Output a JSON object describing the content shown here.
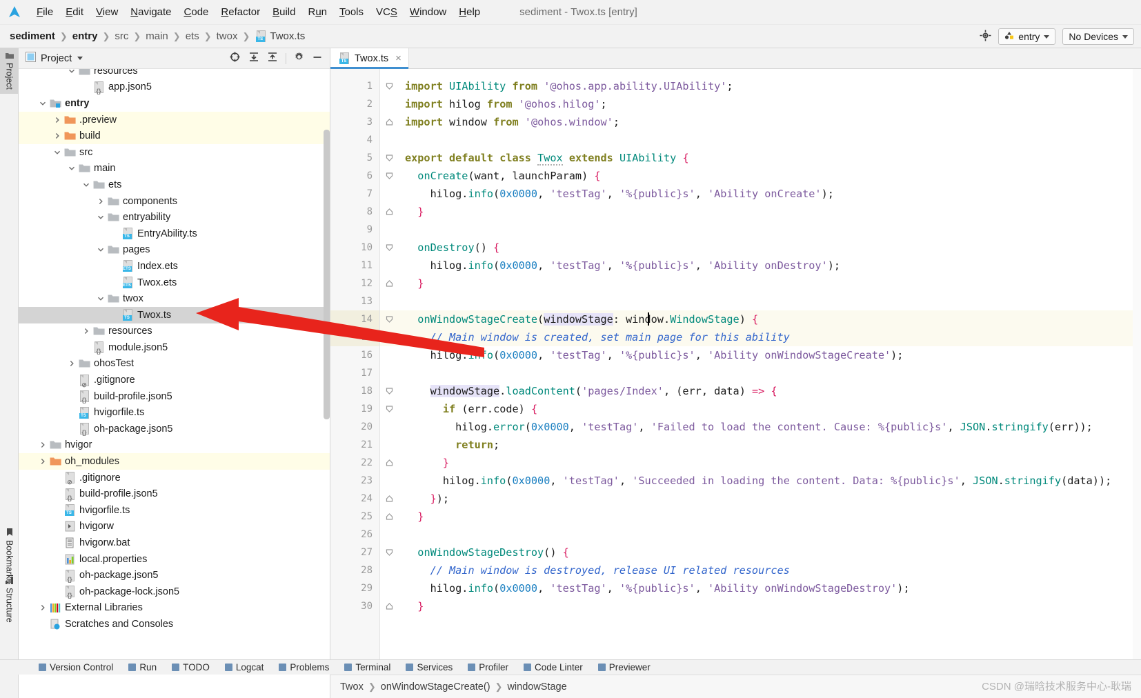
{
  "window": {
    "title": "sediment - Twox.ts [entry]"
  },
  "menubar": {
    "items": [
      {
        "label": "File",
        "mnemonic": "F"
      },
      {
        "label": "Edit",
        "mnemonic": "E"
      },
      {
        "label": "View",
        "mnemonic": "V"
      },
      {
        "label": "Navigate",
        "mnemonic": "N"
      },
      {
        "label": "Code",
        "mnemonic": "C"
      },
      {
        "label": "Refactor",
        "mnemonic": "R"
      },
      {
        "label": "Build",
        "mnemonic": "B"
      },
      {
        "label": "Run",
        "mnemonic": "u"
      },
      {
        "label": "Tools",
        "mnemonic": "T"
      },
      {
        "label": "VCS",
        "mnemonic": "S"
      },
      {
        "label": "Window",
        "mnemonic": "W"
      },
      {
        "label": "Help",
        "mnemonic": "H"
      }
    ]
  },
  "navbar": {
    "breadcrumb": [
      "sediment",
      "entry",
      "src",
      "main",
      "ets",
      "twox",
      "Twox.ts"
    ],
    "run_config": "entry",
    "device_selector": "No Devices"
  },
  "left_strip": {
    "tools": [
      {
        "label": "Project",
        "active": true
      },
      {
        "label": "Bookmarks",
        "active": false
      },
      {
        "label": "Structure",
        "active": false
      }
    ]
  },
  "project_panel": {
    "title": "Project",
    "tree": [
      {
        "label": "resources",
        "depth": 3,
        "type": "folder",
        "arrow": "down",
        "state": "none",
        "clipped": true
      },
      {
        "label": "app.json5",
        "depth": 4,
        "type": "json",
        "arrow": "none",
        "state": "none"
      },
      {
        "label": "entry",
        "depth": 1,
        "type": "module",
        "arrow": "down",
        "state": "none",
        "bold": true
      },
      {
        "label": ".preview",
        "depth": 2,
        "type": "folder-orange",
        "arrow": "right",
        "state": "yellow"
      },
      {
        "label": "build",
        "depth": 2,
        "type": "folder-orange",
        "arrow": "right",
        "state": "yellow"
      },
      {
        "label": "src",
        "depth": 2,
        "type": "folder",
        "arrow": "down",
        "state": "none"
      },
      {
        "label": "main",
        "depth": 3,
        "type": "folder",
        "arrow": "down",
        "state": "none"
      },
      {
        "label": "ets",
        "depth": 4,
        "type": "folder",
        "arrow": "down",
        "state": "none"
      },
      {
        "label": "components",
        "depth": 5,
        "type": "folder",
        "arrow": "right",
        "state": "none"
      },
      {
        "label": "entryability",
        "depth": 5,
        "type": "folder",
        "arrow": "down",
        "state": "none"
      },
      {
        "label": "EntryAbility.ts",
        "depth": 6,
        "type": "ts",
        "arrow": "none",
        "state": "none"
      },
      {
        "label": "pages",
        "depth": 5,
        "type": "folder",
        "arrow": "down",
        "state": "none"
      },
      {
        "label": "Index.ets",
        "depth": 6,
        "type": "ets",
        "arrow": "none",
        "state": "none"
      },
      {
        "label": "Twox.ets",
        "depth": 6,
        "type": "ets",
        "arrow": "none",
        "state": "none"
      },
      {
        "label": "twox",
        "depth": 5,
        "type": "folder",
        "arrow": "down",
        "state": "none"
      },
      {
        "label": "Twox.ts",
        "depth": 6,
        "type": "ts",
        "arrow": "none",
        "state": "selected"
      },
      {
        "label": "resources",
        "depth": 4,
        "type": "folder",
        "arrow": "right",
        "state": "none"
      },
      {
        "label": "module.json5",
        "depth": 4,
        "type": "json",
        "arrow": "none",
        "state": "none"
      },
      {
        "label": "ohosTest",
        "depth": 3,
        "type": "folder",
        "arrow": "right",
        "state": "none"
      },
      {
        "label": ".gitignore",
        "depth": 3,
        "type": "gitignore",
        "arrow": "none",
        "state": "none"
      },
      {
        "label": "build-profile.json5",
        "depth": 3,
        "type": "json",
        "arrow": "none",
        "state": "none"
      },
      {
        "label": "hvigorfile.ts",
        "depth": 3,
        "type": "ts",
        "arrow": "none",
        "state": "none"
      },
      {
        "label": "oh-package.json5",
        "depth": 3,
        "type": "json",
        "arrow": "none",
        "state": "none"
      },
      {
        "label": "hvigor",
        "depth": 1,
        "type": "folder",
        "arrow": "right",
        "state": "none"
      },
      {
        "label": "oh_modules",
        "depth": 1,
        "type": "folder-orange",
        "arrow": "right",
        "state": "yellow"
      },
      {
        "label": ".gitignore",
        "depth": 2,
        "type": "gitignore",
        "arrow": "none",
        "state": "none"
      },
      {
        "label": "build-profile.json5",
        "depth": 2,
        "type": "json",
        "arrow": "none",
        "state": "none"
      },
      {
        "label": "hvigorfile.ts",
        "depth": 2,
        "type": "ts",
        "arrow": "none",
        "state": "none"
      },
      {
        "label": "hvigorw",
        "depth": 2,
        "type": "script",
        "arrow": "none",
        "state": "none"
      },
      {
        "label": "hvigorw.bat",
        "depth": 2,
        "type": "bat",
        "arrow": "none",
        "state": "none"
      },
      {
        "label": "local.properties",
        "depth": 2,
        "type": "props",
        "arrow": "none",
        "state": "none"
      },
      {
        "label": "oh-package.json5",
        "depth": 2,
        "type": "json",
        "arrow": "none",
        "state": "none"
      },
      {
        "label": "oh-package-lock.json5",
        "depth": 2,
        "type": "json",
        "arrow": "none",
        "state": "none"
      },
      {
        "label": "External Libraries",
        "depth": 1,
        "type": "libs",
        "arrow": "right",
        "state": "none"
      },
      {
        "label": "Scratches and Consoles",
        "depth": 1,
        "type": "scratch",
        "arrow": "none",
        "state": "none"
      }
    ]
  },
  "editor": {
    "tab": {
      "label": "Twox.ts",
      "close": "×"
    },
    "breadcrumb": [
      "Twox",
      "onWindowStageCreate()",
      "windowStage"
    ],
    "watermark": "CSDN @瑞晗技术服务中心-耿瑞",
    "code_lines": [
      {
        "n": 1,
        "fold": "start"
      },
      {
        "n": 2,
        "fold": "none"
      },
      {
        "n": 3,
        "fold": "end"
      },
      {
        "n": 4,
        "fold": "none"
      },
      {
        "n": 5,
        "fold": "start"
      },
      {
        "n": 6,
        "fold": "start"
      },
      {
        "n": 7,
        "fold": "none"
      },
      {
        "n": 8,
        "fold": "end"
      },
      {
        "n": 9,
        "fold": "none"
      },
      {
        "n": 10,
        "fold": "start"
      },
      {
        "n": 11,
        "fold": "none"
      },
      {
        "n": 12,
        "fold": "end"
      },
      {
        "n": 13,
        "fold": "none"
      },
      {
        "n": 14,
        "fold": "start",
        "highlight": true
      },
      {
        "n": 15,
        "fold": "none",
        "highlight": true
      },
      {
        "n": 16,
        "fold": "none"
      },
      {
        "n": 17,
        "fold": "none"
      },
      {
        "n": 18,
        "fold": "start"
      },
      {
        "n": 19,
        "fold": "start"
      },
      {
        "n": 20,
        "fold": "none"
      },
      {
        "n": 21,
        "fold": "none"
      },
      {
        "n": 22,
        "fold": "end"
      },
      {
        "n": 23,
        "fold": "none"
      },
      {
        "n": 24,
        "fold": "end"
      },
      {
        "n": 25,
        "fold": "end"
      },
      {
        "n": 26,
        "fold": "none"
      },
      {
        "n": 27,
        "fold": "start"
      },
      {
        "n": 28,
        "fold": "none"
      },
      {
        "n": 29,
        "fold": "none"
      },
      {
        "n": 30,
        "fold": "end"
      }
    ],
    "code_text": [
      "import UIAbility from '@ohos.app.ability.UIAbility';",
      "import hilog from '@ohos.hilog';",
      "import window from '@ohos.window';",
      "",
      "export default class Twox extends UIAbility {",
      "  onCreate(want, launchParam) {",
      "    hilog.info(0x0000, 'testTag', '%{public}s', 'Ability onCreate');",
      "  }",
      "",
      "  onDestroy() {",
      "    hilog.info(0x0000, 'testTag', '%{public}s', 'Ability onDestroy');",
      "  }",
      "",
      "  onWindowStageCreate(windowStage: window.WindowStage) {",
      "    // Main window is created, set main page for this ability",
      "    hilog.info(0x0000, 'testTag', '%{public}s', 'Ability onWindowStageCreate');",
      "",
      "    windowStage.loadContent('pages/Index', (err, data) => {",
      "      if (err.code) {",
      "        hilog.error(0x0000, 'testTag', 'Failed to load the content. Cause: %{public}s', JSON.stringify(err));",
      "        return;",
      "      }",
      "      hilog.info(0x0000, 'testTag', 'Succeeded in loading the content. Data: %{public}s', JSON.stringify(data));",
      "    });",
      "  }",
      "",
      "  onWindowStageDestroy() {",
      "    // Main window is destroyed, release UI related resources",
      "    hilog.info(0x0000, 'testTag', '%{public}s', 'Ability onWindowStageDestroy');",
      "  }"
    ]
  },
  "bottom_bar": {
    "items": [
      "Version Control",
      "Run",
      "TODO",
      "Logcat",
      "Problems",
      "Terminal",
      "Services",
      "Profiler",
      "Code Linter",
      "Previewer"
    ]
  },
  "annotation": {
    "arrow_color": "#e8241c",
    "points_to": "Twox.ts"
  },
  "colors": {
    "selection": "#d4d4d4",
    "highlight_yellow": "#fffde7",
    "tab_underline": "#3f8fd0",
    "accent_blue": "#3ab7e8"
  }
}
